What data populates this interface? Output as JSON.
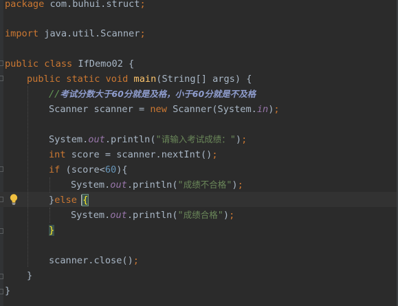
{
  "editor": {
    "language": "Java",
    "colors": {
      "background": "#2b2b2b",
      "keyword": "#cc7832",
      "method": "#ffc66d",
      "string": "#6a8759",
      "field": "#9876aa",
      "number": "#6897bb",
      "comment": "#8f9dce",
      "text": "#a9b7c6"
    },
    "lines": {
      "l1_kw": "package",
      "l1_rest": " com.buhui.struct",
      "l1_semi": ";",
      "l3_kw": "import",
      "l3_rest": " java.util.Scanner",
      "l3_semi": ";",
      "l5_kw1": "public class",
      "l5_rest": " IfDemo02 {",
      "l6_kw": "public static void",
      "l6_sp": " ",
      "l6_fn": "main",
      "l6_rest": "(String[] args) {",
      "l7_comment_slash": "//",
      "l7_comment": "考试分数大于60分就是及格，小于60分就是不及格",
      "l8_a": "Scanner scanner = ",
      "l8_kw": "new",
      "l8_b": " Scanner(System.",
      "l8_fld": "in",
      "l8_c": ")",
      "l8_semi": ";",
      "l10_a": "System.",
      "l10_fld": "out",
      "l10_b": ".println(",
      "l10_str_q1": "\"",
      "l10_str": "请输入考试成绩：",
      "l10_str_q2": "\"",
      "l10_c": ")",
      "l10_semi": ";",
      "l11_kw": "int",
      "l11_a": " score = scanner.nextInt()",
      "l11_semi": ";",
      "l12_kw": "if",
      "l12_a": " (score<",
      "l12_num": "60",
      "l12_b": "){",
      "l13_a": "System.",
      "l13_fld": "out",
      "l13_b": ".println(",
      "l13_str_q1": "\"",
      "l13_str": "成绩不合格",
      "l13_str_q2": "\"",
      "l13_c": ")",
      "l13_semi": ";",
      "l14_a": "}",
      "l14_kw": "else",
      "l14_sp": " ",
      "l14_brace": "{",
      "l15_a": "System.",
      "l15_fld": "out",
      "l15_b": ".println(",
      "l15_str_q1": "\"",
      "l15_str": "成绩合格",
      "l15_str_q2": "\"",
      "l15_c": ")",
      "l15_semi": ";",
      "l16_brace": "}",
      "l18_a": "scanner.close()",
      "l18_semi": ";",
      "l19_a": "}",
      "l20_a": "}"
    }
  }
}
